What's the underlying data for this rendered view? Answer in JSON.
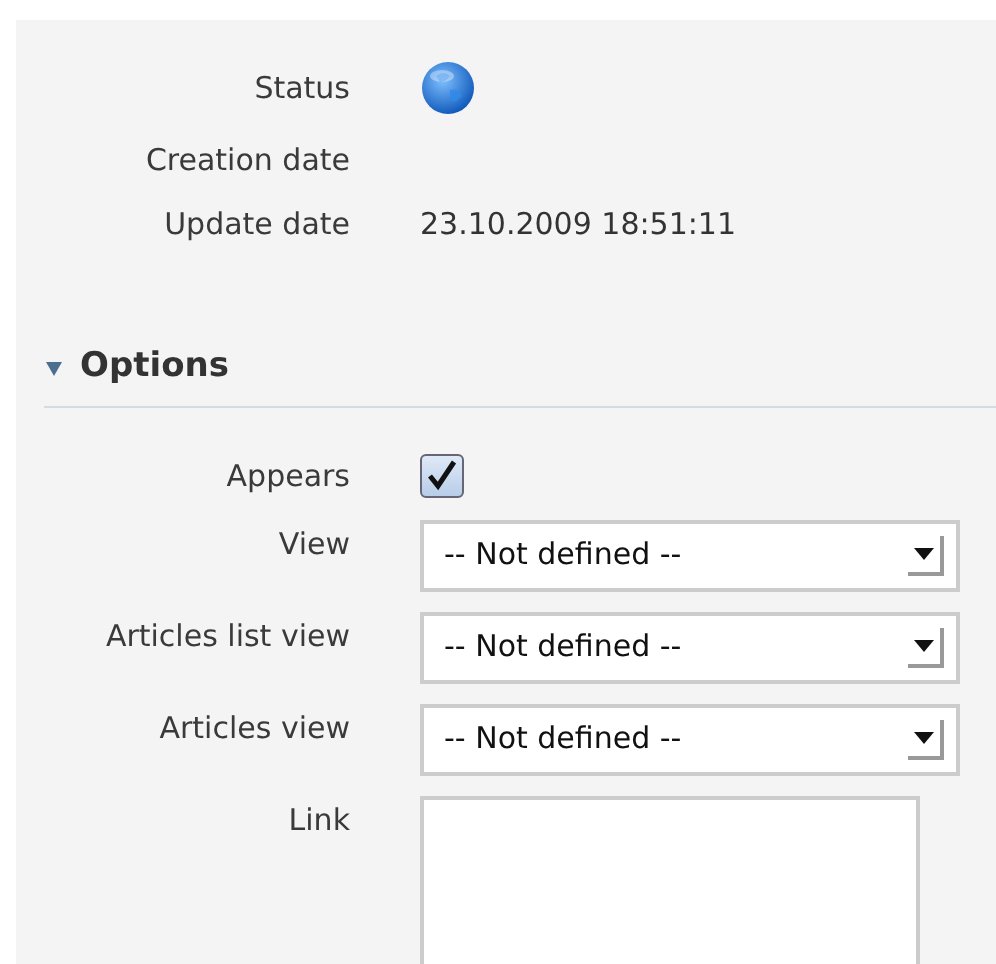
{
  "info_rows": [
    {
      "label": "Status",
      "kind": "icon"
    },
    {
      "label": "Creation date",
      "kind": "text"
    },
    {
      "label": "Update date",
      "kind": "text",
      "value": "23.10.2009 18:51:11"
    }
  ],
  "section": {
    "title": "Options",
    "expanded": true
  },
  "options": [
    {
      "label": "Appears",
      "kind": "checkbox",
      "checked": true
    },
    {
      "label": "View",
      "kind": "select",
      "value": "-- Not defined --"
    },
    {
      "label": "Articles list view",
      "kind": "select",
      "value": "-- Not defined --"
    },
    {
      "label": "Articles view",
      "kind": "select",
      "value": "-- Not defined --"
    },
    {
      "label": "Link",
      "kind": "textarea"
    }
  ]
}
